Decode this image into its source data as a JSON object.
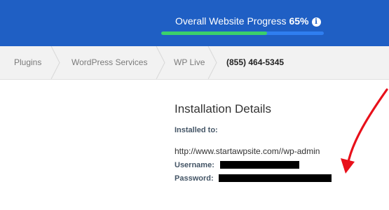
{
  "progress": {
    "label": "Overall Website Progress",
    "percent_text": "65%",
    "percent_value": 0.65,
    "info_icon": "info-icon",
    "track_color": "#2f7ef0",
    "fill_color": "#3bd06b"
  },
  "breadcrumb": {
    "items": [
      "Plugins",
      "WordPress Services",
      "WP Live"
    ],
    "phone": "(855) 464-5345"
  },
  "installation": {
    "title": "Installation Details",
    "installed_to_label": "Installed to:",
    "url": "http://www.startawpsite.com//wp-admin",
    "username_label": "Username:",
    "password_label": "Password:"
  },
  "colors": {
    "header_bg": "#1f5fc4",
    "arrow": "#e8101a"
  }
}
